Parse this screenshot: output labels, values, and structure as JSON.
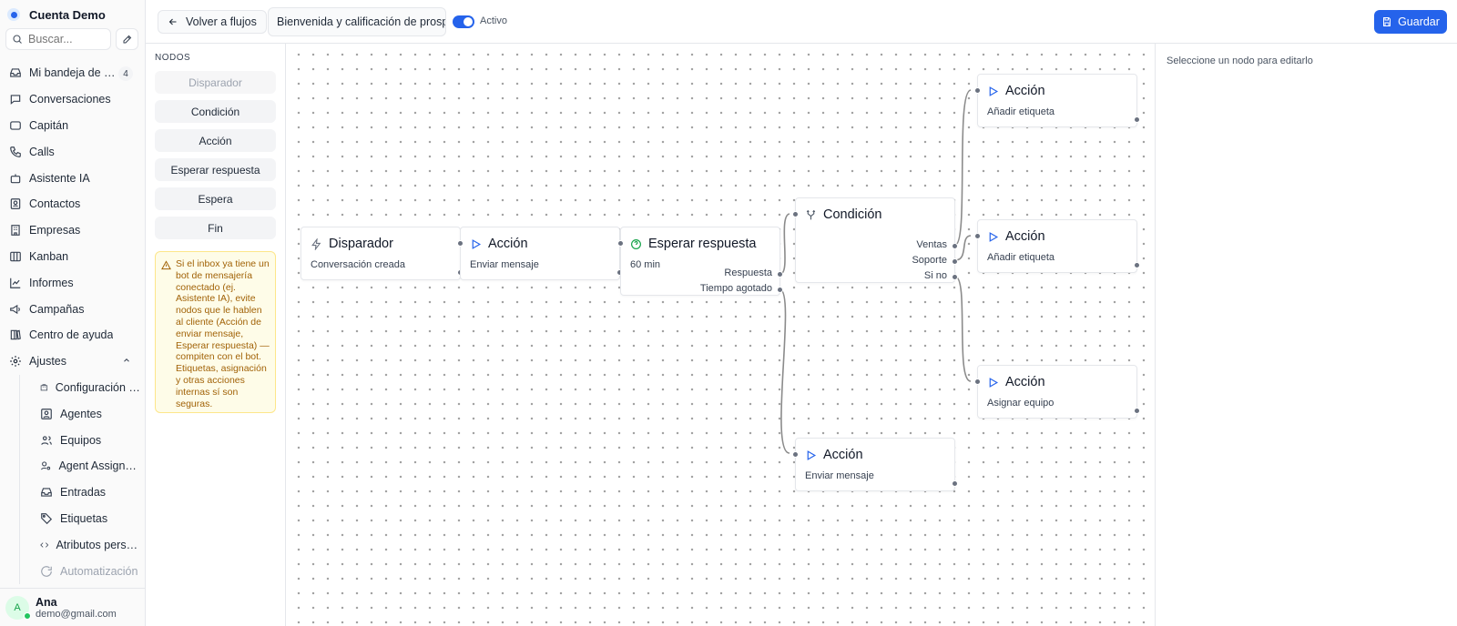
{
  "app": {
    "account_name": "Cuenta Demo"
  },
  "sidebar": {
    "search_placeholder": "Buscar...",
    "items": [
      {
        "label": "Mi bandeja de entrada",
        "badge": "4"
      },
      {
        "label": "Conversaciones"
      },
      {
        "label": "Capitán"
      },
      {
        "label": "Calls"
      },
      {
        "label": "Asistente IA"
      },
      {
        "label": "Contactos"
      },
      {
        "label": "Empresas"
      },
      {
        "label": "Kanban"
      },
      {
        "label": "Informes"
      },
      {
        "label": "Campañas"
      },
      {
        "label": "Centro de ayuda"
      },
      {
        "label": "Ajustes"
      }
    ],
    "settings_items": [
      {
        "label": "Configuración de la cuenta"
      },
      {
        "label": "Agentes"
      },
      {
        "label": "Equipos"
      },
      {
        "label": "Agent Assignment"
      },
      {
        "label": "Entradas"
      },
      {
        "label": "Etiquetas"
      },
      {
        "label": "Atributos personalizados"
      },
      {
        "label": "Automatización"
      }
    ],
    "user": {
      "initial": "A",
      "name": "Ana",
      "email": "demo@gmail.com"
    }
  },
  "header": {
    "back_label": "Volver a flujos",
    "flow_name": "Bienvenida y calificación de prospectos",
    "status_label": "Activo",
    "save_label": "Guardar"
  },
  "palette": {
    "title": "NODOS",
    "items": [
      "Disparador",
      "Condición",
      "Acción",
      "Esperar respuesta",
      "Espera",
      "Fin"
    ],
    "warning": "Si el inbox ya tiene un bot de mensajería conectado (ej. Asistente IA), evite nodos que le hablen al cliente (Acción de enviar mensaje, Esperar respuesta) — compiten con el bot. Etiquetas, asignación y otras acciones internas sí son seguras."
  },
  "nodes": {
    "trigger": {
      "title": "Disparador",
      "subtitle": "Conversación creada"
    },
    "action_send": {
      "title": "Acción",
      "subtitle": "Enviar mensaje"
    },
    "wait": {
      "title": "Esperar respuesta",
      "subtitle": "60 min",
      "outputs": [
        "Respuesta",
        "Tiempo agotado"
      ]
    },
    "condition": {
      "title": "Condición",
      "outputs": [
        "Ventas",
        "Soporte",
        "Si no"
      ]
    },
    "action_tag_1": {
      "title": "Acción",
      "subtitle": "Añadir etiqueta"
    },
    "action_tag_2": {
      "title": "Acción",
      "subtitle": "Añadir etiqueta"
    },
    "action_team": {
      "title": "Acción",
      "subtitle": "Asignar equipo"
    },
    "action_send_2": {
      "title": "Acción",
      "subtitle": "Enviar mensaje"
    }
  },
  "inspector": {
    "hint": "Seleccione un nodo para editarlo"
  },
  "colors": {
    "accent": "#2563eb",
    "warning_bg": "#fefce8",
    "warning_text": "#a16207"
  }
}
